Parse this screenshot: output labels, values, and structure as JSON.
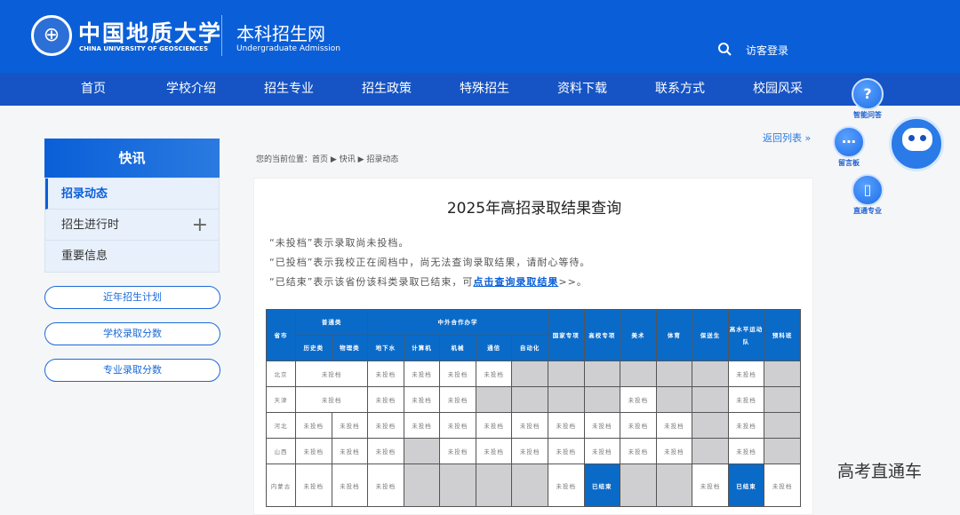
{
  "header": {
    "logo_cn": "中国地质大学",
    "logo_en": "CHINA UNIVERSITY OF GEOSCIENCES",
    "site_title": "本科招生网",
    "site_subtitle": "Undergraduate Admission",
    "login": "访客登录"
  },
  "nav": [
    "首页",
    "学校介绍",
    "招生专业",
    "招生政策",
    "特殊招生",
    "资料下载",
    "联系方式",
    "校园风采"
  ],
  "sidebar": {
    "title": "快讯",
    "items": [
      {
        "label": "招录动态"
      },
      {
        "label": "招生进行时"
      },
      {
        "label": "重要信息"
      }
    ],
    "links": [
      "近年招生计划",
      "学校录取分数",
      "专业录取分数"
    ]
  },
  "back_link": "返回列表 »",
  "breadcrumb": {
    "prefix": "您的当前位置：",
    "items": [
      "首页",
      "快讯",
      "招录动态"
    ]
  },
  "article": {
    "title": "2025年高招录取结果查询",
    "notes": [
      "“未投档”表示录取尚未投档。",
      "“已投档”表示我校正在阅档中，尚无法查询录取结果，请耐心等待。"
    ],
    "note3_prefix": "“已结束”表示该省份该科类录取已结束，可",
    "note3_link": "点击查询录取结果",
    "note3_suffix": ">>。"
  },
  "table": {
    "h_province": "省市",
    "h_general": "普通类",
    "h_general_sub": [
      "历史类",
      "物理类"
    ],
    "h_coop": "中外合作办学",
    "h_coop_sub": [
      "地下水",
      "计算机",
      "机械",
      "通信",
      "自动化"
    ],
    "h_others": [
      "国家专项",
      "高校专项",
      "美术",
      "体育",
      "保送生",
      "高水平运动队",
      "预科班"
    ],
    "rows": [
      {
        "province": "北京",
        "merged_general": "未投档",
        "cells": [
          "未投档",
          "未投档",
          "未投档",
          "未投档",
          null,
          null,
          null,
          null,
          null,
          null,
          "未投档",
          null
        ]
      },
      {
        "province": "天津",
        "merged_general": "未投档",
        "cells": [
          "未投档",
          "未投档",
          "未投档",
          null,
          null,
          null,
          null,
          "未投档",
          null,
          null,
          "未投档",
          null
        ]
      },
      {
        "province": "河北",
        "general": [
          "未投档",
          "未投档"
        ],
        "cells": [
          "未投档",
          "未投档",
          "未投档",
          "未投档",
          "未投档",
          "未投档",
          "未投档",
          "未投档",
          "未投档",
          null,
          "未投档",
          null
        ]
      },
      {
        "province": "山西",
        "general": [
          "未投档",
          "未投档"
        ],
        "cells": [
          "未投档",
          null,
          "未投档",
          "未投档",
          "未投档",
          "未投档",
          "未投档",
          "未投档",
          "未投档",
          null,
          "未投档",
          null
        ]
      },
      {
        "province": "内蒙古",
        "general": [
          "未投档",
          "未投档"
        ],
        "cells": [
          "未投档",
          null,
          null,
          null,
          null,
          "未投档",
          "已结束",
          null,
          null,
          "未投档",
          "已结束",
          "未投档"
        ]
      }
    ]
  },
  "floating": [
    "智能问答",
    "留言板",
    "直通专业"
  ],
  "watermark": "高考直通车",
  "colors": {
    "brand": "#0a5fd8",
    "nav": "#1654c5",
    "table_header": "#0a6ac8",
    "na_cell": "#cfcfd1"
  }
}
